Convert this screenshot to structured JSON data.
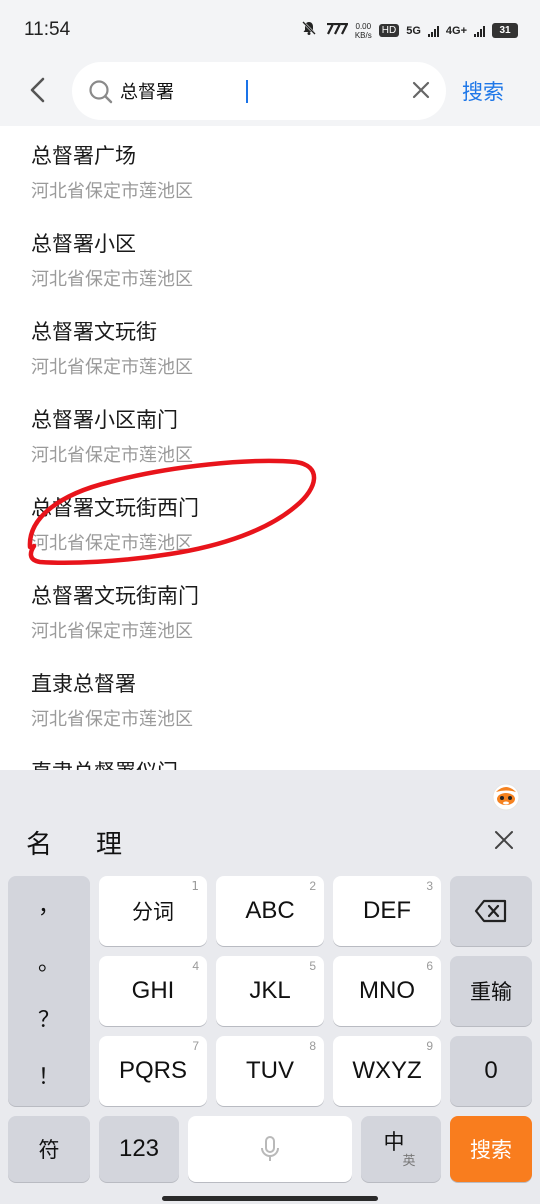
{
  "status_bar": {
    "time": "11:54",
    "net_speed_value": "0.00",
    "net_speed_unit": "KB/s",
    "hd": "HD",
    "network_5g": "5G",
    "network_4g": "4G+",
    "battery": "31"
  },
  "search": {
    "query": "总督署",
    "action_label": "搜索"
  },
  "results": [
    {
      "title": "总督署广场",
      "address": "河北省保定市莲池区"
    },
    {
      "title": "总督署小区",
      "address": "河北省保定市莲池区"
    },
    {
      "title": "总督署文玩街",
      "address": "河北省保定市莲池区"
    },
    {
      "title": "总督署小区南门",
      "address": "河北省保定市莲池区"
    },
    {
      "title": "总督署文玩街西门",
      "address": "河北省保定市莲池区"
    },
    {
      "title": "总督署文玩街南门",
      "address": "河北省保定市莲池区"
    },
    {
      "title": "直隶总督署",
      "address": "河北省保定市莲池区"
    },
    {
      "title": "直隶总督署仪门",
      "address": ""
    }
  ],
  "annotation": {
    "color": "#e8141b",
    "target_index": 4
  },
  "keyboard": {
    "candidates": [
      "名",
      "理"
    ],
    "punctuation": [
      "，",
      "。",
      "？",
      "！"
    ],
    "keys_row1": [
      {
        "label": "分词",
        "num": "1"
      },
      {
        "label": "ABC",
        "num": "2"
      },
      {
        "label": "DEF",
        "num": "3"
      }
    ],
    "keys_row2": [
      {
        "label": "GHI",
        "num": "4"
      },
      {
        "label": "JKL",
        "num": "5"
      },
      {
        "label": "MNO",
        "num": "6"
      }
    ],
    "keys_row3": [
      {
        "label": "PQRS",
        "num": "7"
      },
      {
        "label": "TUV",
        "num": "8"
      },
      {
        "label": "WXYZ",
        "num": "9"
      }
    ],
    "reinput_label": "重输",
    "zero_label": "0",
    "symbol_label": "符",
    "num_label": "123",
    "lang_primary": "中",
    "lang_secondary": "英",
    "search_label": "搜索",
    "search_color": "#f97d1e"
  }
}
